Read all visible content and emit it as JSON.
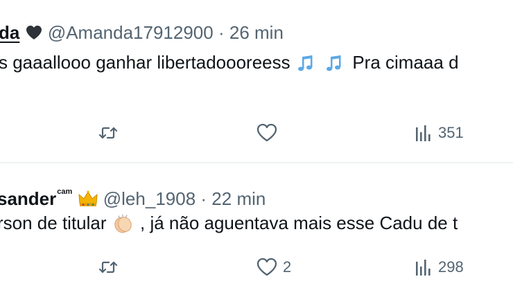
{
  "tweets": [
    {
      "display_name": "da",
      "handle": "@Amanda17912900",
      "separator": "·",
      "time": "26 min",
      "text_before_emoji": "s gaaallooo ganhar libertadoooreess",
      "text_after_emoji": "Pra cimaaa d",
      "emojis": [
        "black-heart-icon",
        "musical-notes-icon",
        "musical-notes-icon"
      ],
      "actions": {
        "retweet_count": "",
        "like_count": "",
        "views_count": "351"
      }
    },
    {
      "display_name": "sander",
      "name_superscript": "cam",
      "handle": "@leh_1908",
      "separator": "·",
      "time": "22 min",
      "text_before_emoji": "rson de titular",
      "text_after_emoji": ", já não aguentava mais esse Cadu de t",
      "emojis": [
        "crown-icon",
        "clapping-hands-icon"
      ],
      "actions": {
        "retweet_count": "",
        "like_count": "2",
        "views_count": "298"
      }
    }
  ],
  "colors": {
    "text": "#0f1419",
    "secondary": "#536471",
    "divider": "#eff3f4",
    "notes_blue": "#5aa9e6",
    "crown_gold": "#f4b400"
  }
}
